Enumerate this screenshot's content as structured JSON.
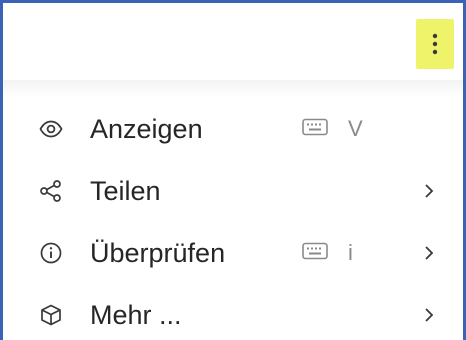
{
  "toolbar": {
    "more_button_icon": "more-vertical-icon",
    "highlight_color": "#eef36a"
  },
  "menu": {
    "items": [
      {
        "label": "Anzeigen",
        "icon": "eye-icon",
        "shortcut_icon": "keyboard-icon",
        "shortcut_key": "V",
        "has_submenu": false
      },
      {
        "label": "Teilen",
        "icon": "share-icon",
        "has_submenu": true
      },
      {
        "label": "Überprüfen",
        "icon": "info-icon",
        "shortcut_icon": "keyboard-icon",
        "shortcut_key": "i",
        "has_submenu": true
      },
      {
        "label": "Mehr ...",
        "icon": "cube-icon",
        "has_submenu": true
      }
    ]
  },
  "colors": {
    "frame_border": "#3a63b8",
    "text": "#262626",
    "muted": "#8a8a8a"
  }
}
